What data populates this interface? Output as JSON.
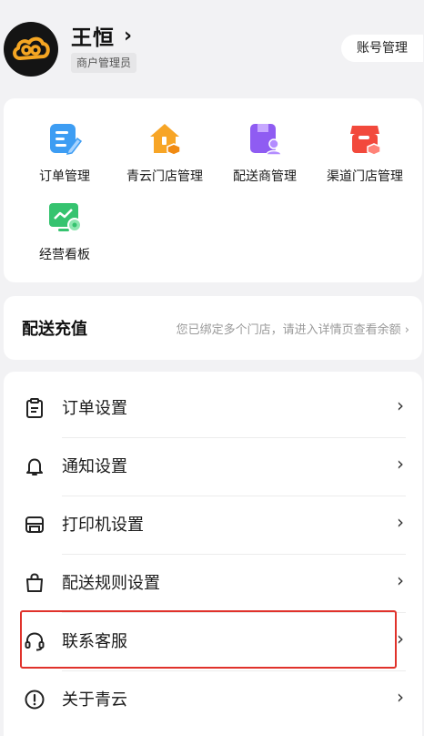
{
  "header": {
    "user_name": "王恒",
    "role": "商户管理员",
    "account_button": "账号管理",
    "logo_icon": "cloud-logo-icon",
    "chevron_icon": "chevron-right-icon"
  },
  "quick_actions": [
    {
      "label": "订单管理",
      "icon": "order-doc-icon",
      "color": "#3d9df3"
    },
    {
      "label": "青云门店管理",
      "icon": "store-house-icon",
      "color": "#f7a526"
    },
    {
      "label": "配送商管理",
      "icon": "courier-user-icon",
      "color": "#8f5cf2"
    },
    {
      "label": "渠道门店管理",
      "icon": "channel-store-icon",
      "color": "#f2493c"
    },
    {
      "label": "经营看板",
      "icon": "dashboard-chart-icon",
      "color": "#35c36f"
    }
  ],
  "recharge": {
    "title": "配送充值",
    "description": "您已绑定多个门店，请进入详情页查看余额 ›"
  },
  "settings": [
    {
      "label": "订单设置",
      "icon": "clipboard-icon"
    },
    {
      "label": "通知设置",
      "icon": "bell-icon"
    },
    {
      "label": "打印机设置",
      "icon": "printer-icon"
    },
    {
      "label": "配送规则设置",
      "icon": "shopping-bag-icon"
    },
    {
      "label": "联系客服",
      "icon": "headset-icon"
    },
    {
      "label": "关于青云",
      "icon": "info-circle-icon"
    }
  ],
  "chevron": "›"
}
